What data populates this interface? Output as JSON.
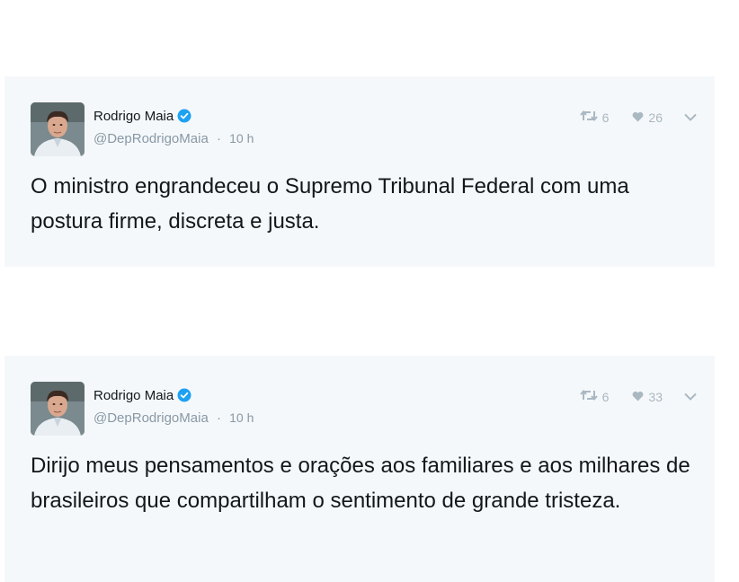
{
  "tweets": [
    {
      "author": {
        "name": "Rodrigo Maia",
        "handle": "@DepRodrigoMaia",
        "verified": true
      },
      "separator": "·",
      "time": "10 h",
      "retweets": "6",
      "likes": "26",
      "text": "O ministro engrandeceu o Supremo Tribunal Federal com uma postura firme, discreta e justa."
    },
    {
      "author": {
        "name": "Rodrigo Maia",
        "handle": "@DepRodrigoMaia",
        "verified": true
      },
      "separator": "·",
      "time": "10 h",
      "retweets": "6",
      "likes": "33",
      "text": "Dirijo meus pensamentos e orações aos familiares e aos milhares de brasileiros que compartilham o sentimento de grande tristeza."
    }
  ],
  "colors": {
    "card_background": "#f5f8fa",
    "text": "#14171a",
    "muted": "#8899a6",
    "icon": "#aab8c2",
    "verified": "#1da1f2"
  },
  "icons": [
    "retweet-icon",
    "heart-icon",
    "chevron-down-icon",
    "verified-badge-icon"
  ]
}
